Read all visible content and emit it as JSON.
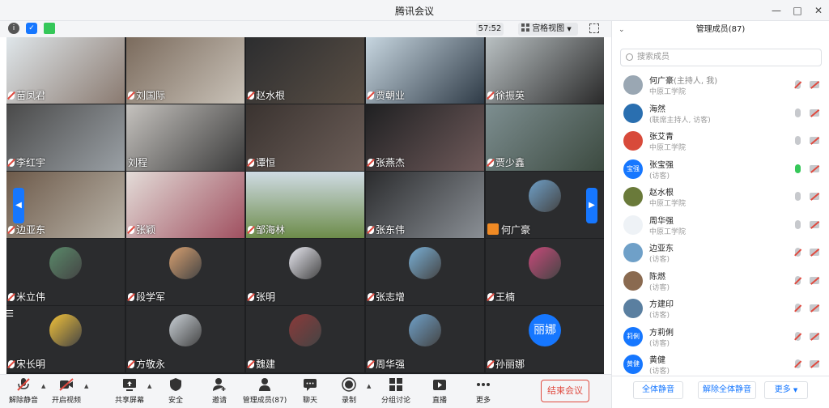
{
  "window": {
    "title": "腾讯会议"
  },
  "status": {
    "timer": "57:52",
    "view_label": "宫格视图"
  },
  "tiles": [
    {
      "name": "苗凤君"
    },
    {
      "name": "刘国际"
    },
    {
      "name": "赵水根"
    },
    {
      "name": "贾朝业"
    },
    {
      "name": "徐振英"
    },
    {
      "name": "李红宇"
    },
    {
      "name": "刘程"
    },
    {
      "name": "谭恒"
    },
    {
      "name": "张燕杰"
    },
    {
      "name": "贾少鑫"
    },
    {
      "name": "边亚东"
    },
    {
      "name": "张颖"
    },
    {
      "name": "邹海林"
    },
    {
      "name": "张东伟"
    },
    {
      "name": "何广豪"
    },
    {
      "name": "米立伟"
    },
    {
      "name": "段学军"
    },
    {
      "name": "张明"
    },
    {
      "name": "张志增"
    },
    {
      "name": "王楠"
    },
    {
      "name": "宋长明"
    },
    {
      "name": "方敬永"
    },
    {
      "name": "魏建"
    },
    {
      "name": "周华强"
    },
    {
      "name": "孙丽娜",
      "avatar_text": "丽娜"
    }
  ],
  "toolbar": {
    "unmute": "解除静音",
    "start_video": "开启视频",
    "share_screen": "共享屏幕",
    "security": "安全",
    "invite": "邀请",
    "members": "管理成员(87)",
    "chat": "聊天",
    "record": "录制",
    "breakout": "分组讨论",
    "live": "直播",
    "more": "更多",
    "end_meeting": "结束会议"
  },
  "panel": {
    "title": "管理成员(87)",
    "search_placeholder": "搜索成员",
    "members": [
      {
        "name": "何广豪",
        "role": "(主持人, 我)",
        "org": "中原工学院"
      },
      {
        "name": "海然",
        "role": "",
        "org": "(联席主持人, 访客)"
      },
      {
        "name": "张艾青",
        "role": "",
        "org": "中原工学院"
      },
      {
        "name": "张宝强",
        "role": "",
        "org": "(访客)",
        "avatar_text": "宝强"
      },
      {
        "name": "赵水根",
        "role": "",
        "org": "中原工学院"
      },
      {
        "name": "周华强",
        "role": "",
        "org": "中原工学院"
      },
      {
        "name": "边亚东",
        "role": "",
        "org": "(访客)"
      },
      {
        "name": "陈燃",
        "role": "",
        "org": "(访客)"
      },
      {
        "name": "方建印",
        "role": "",
        "org": "(访客)"
      },
      {
        "name": "方莉俐",
        "role": "",
        "org": "(访客)",
        "avatar_text": "莉俐"
      },
      {
        "name": "黄健",
        "role": "",
        "org": "(访客)",
        "avatar_text": "黄健"
      }
    ],
    "mute_all": "全体静音",
    "unmute_all": "解除全体静音",
    "more": "更多"
  },
  "colors": {
    "accent": "#1677ff",
    "danger": "#e04a3f",
    "grid_bg": "#1e1f21"
  }
}
